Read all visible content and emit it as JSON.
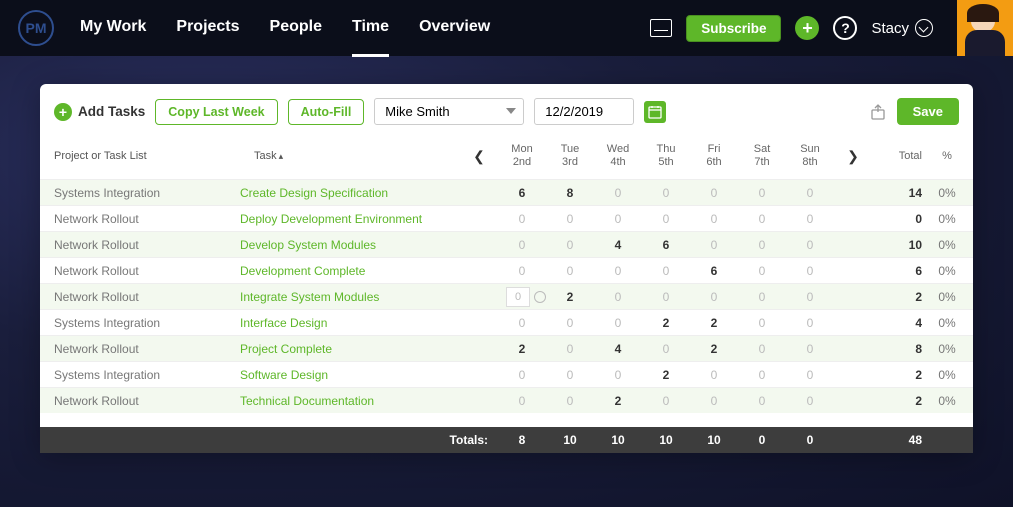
{
  "header": {
    "logo": "PM",
    "nav": [
      "My Work",
      "Projects",
      "People",
      "Time",
      "Overview"
    ],
    "activeNav": 3,
    "subscribe": "Subscribe",
    "userName": "Stacy"
  },
  "toolbar": {
    "addTasks": "Add Tasks",
    "copyLastWeek": "Copy Last Week",
    "autoFill": "Auto-Fill",
    "person": "Mike Smith",
    "date": "12/2/2019",
    "save": "Save"
  },
  "columns": {
    "project": "Project or Task List",
    "task": "Task",
    "days": [
      {
        "dow": "Mon",
        "date": "2nd"
      },
      {
        "dow": "Tue",
        "date": "3rd"
      },
      {
        "dow": "Wed",
        "date": "4th"
      },
      {
        "dow": "Thu",
        "date": "5th"
      },
      {
        "dow": "Fri",
        "date": "6th"
      },
      {
        "dow": "Sat",
        "date": "7th"
      },
      {
        "dow": "Sun",
        "date": "8th"
      }
    ],
    "total": "Total",
    "percent": "%"
  },
  "rows": [
    {
      "project": "Systems Integration",
      "task": "Create Design Specification",
      "h": [
        6,
        8,
        0,
        0,
        0,
        0,
        0
      ],
      "total": 14,
      "pct": "0%"
    },
    {
      "project": "Network Rollout",
      "task": "Deploy Development Environment",
      "h": [
        0,
        0,
        0,
        0,
        0,
        0,
        0
      ],
      "total": 0,
      "pct": "0%"
    },
    {
      "project": "Network Rollout",
      "task": "Develop System Modules",
      "h": [
        0,
        0,
        4,
        6,
        0,
        0,
        0
      ],
      "total": 10,
      "pct": "0%"
    },
    {
      "project": "Network Rollout",
      "task": "Development Complete",
      "h": [
        0,
        0,
        0,
        0,
        6,
        0,
        0
      ],
      "total": 6,
      "pct": "0%"
    },
    {
      "project": "Network Rollout",
      "task": "Integrate System Modules",
      "h": [
        0,
        2,
        0,
        0,
        0,
        0,
        0
      ],
      "total": 2,
      "pct": "0%",
      "editing": 0
    },
    {
      "project": "Systems Integration",
      "task": "Interface Design",
      "h": [
        0,
        0,
        0,
        2,
        2,
        0,
        0
      ],
      "total": 4,
      "pct": "0%"
    },
    {
      "project": "Network Rollout",
      "task": "Project Complete",
      "h": [
        2,
        0,
        4,
        0,
        2,
        0,
        0
      ],
      "total": 8,
      "pct": "0%"
    },
    {
      "project": "Systems Integration",
      "task": "Software Design",
      "h": [
        0,
        0,
        0,
        2,
        0,
        0,
        0
      ],
      "total": 2,
      "pct": "0%"
    },
    {
      "project": "Network Rollout",
      "task": "Technical Documentation",
      "h": [
        0,
        0,
        2,
        0,
        0,
        0,
        0
      ],
      "total": 2,
      "pct": "0%"
    }
  ],
  "totals": {
    "label": "Totals:",
    "h": [
      8,
      10,
      10,
      10,
      10,
      0,
      0
    ],
    "total": 48
  }
}
